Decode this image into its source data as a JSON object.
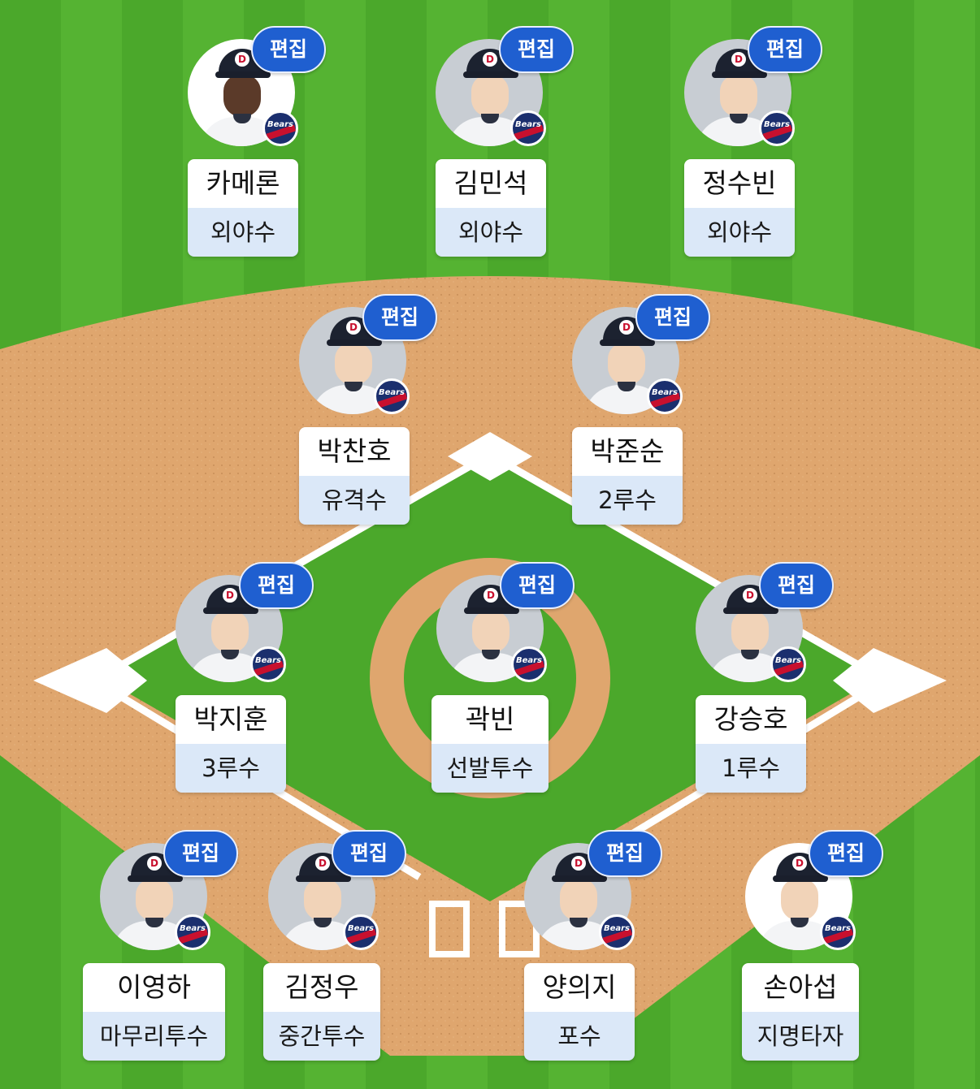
{
  "edit_label": "편집",
  "team": {
    "badge_text": "Bears",
    "cap_letter": "D"
  },
  "colors": {
    "grass": "#4aa62a",
    "infield_dirt": "#dfa66e",
    "edit_button": "#1f5fd0",
    "position_bg": "#dbe8f8",
    "team_navy": "#1b2f6e",
    "team_red": "#c8102e"
  },
  "players": [
    {
      "name": "카메론",
      "position": "외야수"
    },
    {
      "name": "김민석",
      "position": "외야수"
    },
    {
      "name": "정수빈",
      "position": "외야수"
    },
    {
      "name": "박찬호",
      "position": "유격수"
    },
    {
      "name": "박준순",
      "position": "2루수"
    },
    {
      "name": "박지훈",
      "position": "3루수"
    },
    {
      "name": "곽빈",
      "position": "선발투수"
    },
    {
      "name": "강승호",
      "position": "1루수"
    },
    {
      "name": "이영하",
      "position": "마무리투수"
    },
    {
      "name": "김정우",
      "position": "중간투수"
    },
    {
      "name": "양의지",
      "position": "포수"
    },
    {
      "name": "손아섭",
      "position": "지명타자"
    }
  ]
}
